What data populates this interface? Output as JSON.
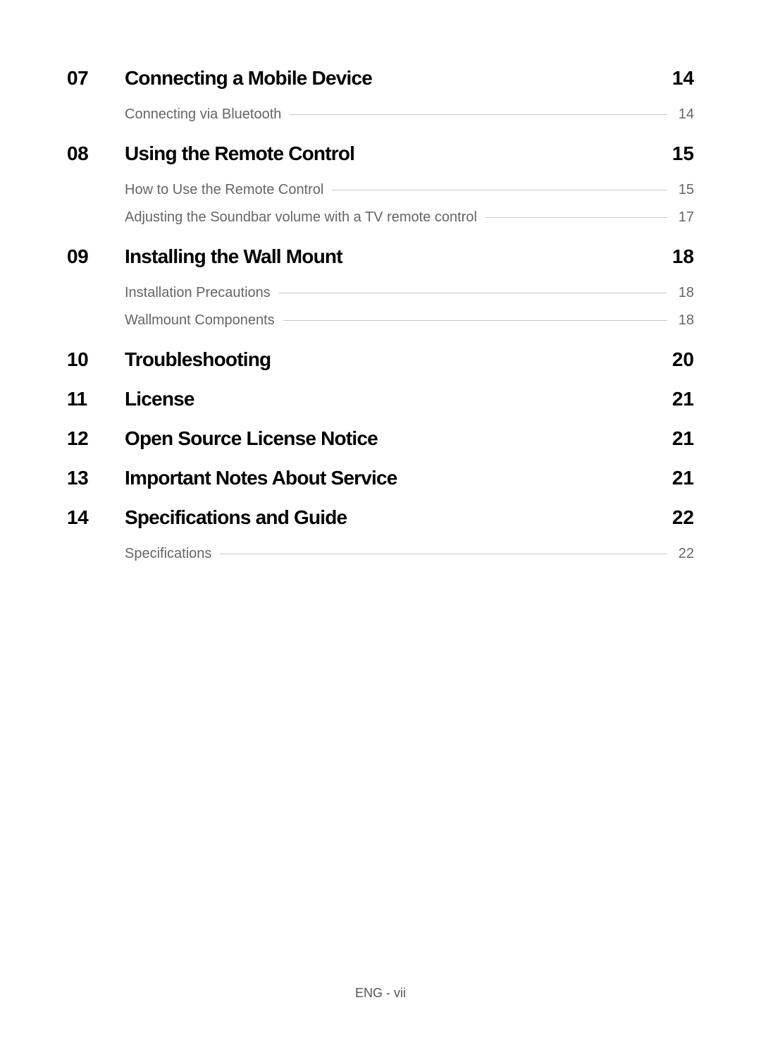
{
  "sections": [
    {
      "number": "07",
      "title": "Connecting a Mobile Device",
      "page": "14",
      "subitems": [
        {
          "title": "Connecting via Bluetooth",
          "page": "14"
        }
      ]
    },
    {
      "number": "08",
      "title": "Using the Remote Control",
      "page": "15",
      "subitems": [
        {
          "title": "How to Use the Remote Control",
          "page": "15"
        },
        {
          "title": "Adjusting the Soundbar volume with a TV remote control",
          "page": "17"
        }
      ]
    },
    {
      "number": "09",
      "title": "Installing the Wall Mount",
      "page": "18",
      "subitems": [
        {
          "title": "Installation Precautions",
          "page": "18"
        },
        {
          "title": "Wallmount Components",
          "page": "18"
        }
      ]
    },
    {
      "number": "10",
      "title": "Troubleshooting",
      "page": "20",
      "subitems": []
    },
    {
      "number": "11",
      "title": "License",
      "page": "21",
      "subitems": []
    },
    {
      "number": "12",
      "title": "Open Source License Notice",
      "page": "21",
      "subitems": []
    },
    {
      "number": "13",
      "title": "Important Notes About Service",
      "page": "21",
      "subitems": []
    },
    {
      "number": "14",
      "title": "Specifications and Guide",
      "page": "22",
      "subitems": [
        {
          "title": "Specifications",
          "page": "22"
        }
      ]
    }
  ],
  "footer": "ENG - vii"
}
